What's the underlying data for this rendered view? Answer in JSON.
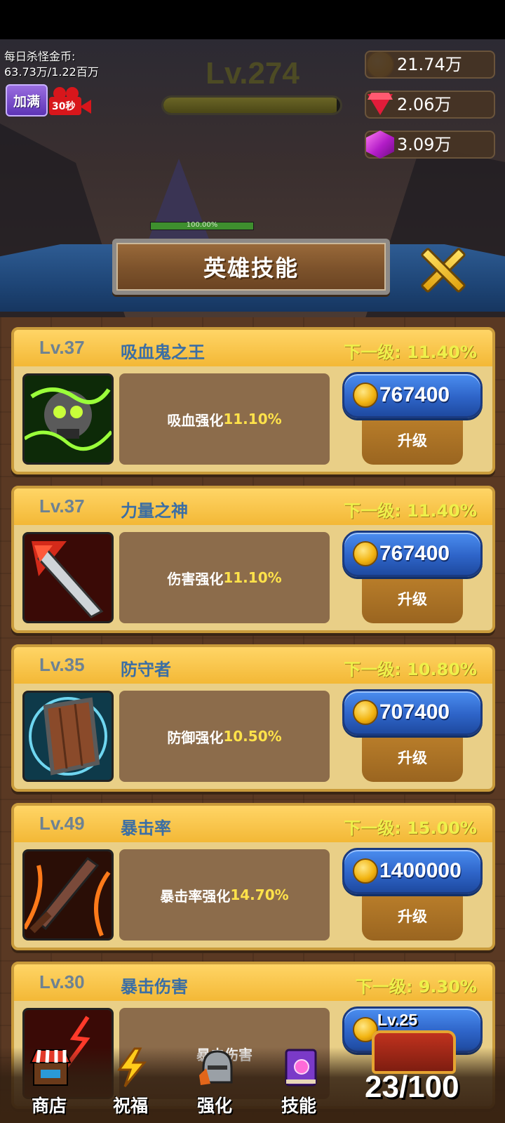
{
  "hud": {
    "kill_gold_label": "每日杀怪金币:",
    "kill_gold_value": "63.73万/1.22百万",
    "fill_button": "加满",
    "video_timer": "30秒",
    "player_level": "Lv.274",
    "xp_fraction": 0.98,
    "currencies": [
      {
        "icon": "gold-coin-icon",
        "value": "21.74万"
      },
      {
        "icon": "ruby-icon",
        "value": "2.06万"
      },
      {
        "icon": "purple-gem-icon",
        "value": "3.09万"
      }
    ],
    "hp_label": "100.00%",
    "hp_fraction": 1.0
  },
  "dialog": {
    "title": "英雄技能"
  },
  "skills": [
    {
      "level": "Lv.37",
      "name": "吸血鬼之王",
      "next": "下一级: 11.40%",
      "desc_text": "吸血强化",
      "desc_pct": "11.10%",
      "cost": "767400",
      "upgrade": "升级",
      "icon": "vampire-skull-icon"
    },
    {
      "level": "Lv.37",
      "name": "力量之神",
      "next": "下一级: 11.40%",
      "desc_text": "伤害强化",
      "desc_pct": "11.10%",
      "cost": "767400",
      "upgrade": "升级",
      "icon": "sword-strike-icon"
    },
    {
      "level": "Lv.35",
      "name": "防守者",
      "next": "下一级: 10.80%",
      "desc_text": "防御强化",
      "desc_pct": "10.50%",
      "cost": "707400",
      "upgrade": "升级",
      "icon": "wooden-shield-icon"
    },
    {
      "level": "Lv.49",
      "name": "暴击率",
      "next": "下一级: 15.00%",
      "desc_text": "暴击率强化",
      "desc_pct": "14.70%",
      "cost": "1400000",
      "upgrade": "升级",
      "icon": "flaming-sword-icon"
    },
    {
      "level": "Lv.30",
      "name": "暴击伤害",
      "next": "下一级: 9.30%",
      "desc_text": "暴击伤害",
      "desc_pct": "",
      "cost": "",
      "upgrade": "",
      "icon": "critical-damage-icon"
    }
  ],
  "bottom_nav": [
    {
      "label": "商店",
      "icon": "shop-stall-icon"
    },
    {
      "label": "祝福",
      "icon": "lightning-icon"
    },
    {
      "label": "强化",
      "icon": "armor-helmet-icon"
    },
    {
      "label": "技能",
      "icon": "spellbook-icon"
    }
  ],
  "chest": {
    "level": "Lv.25",
    "count": "23/100",
    "icon": "treasure-chest-icon"
  },
  "colors": {
    "card_bg": "#e9cf87",
    "card_header": "#f3b836",
    "level_text": "#6e8292",
    "name_text": "#3b6ea4",
    "next_text": "#eef04a",
    "price_button": "#2e64c8",
    "percent_highlight": "#ffe24a"
  }
}
